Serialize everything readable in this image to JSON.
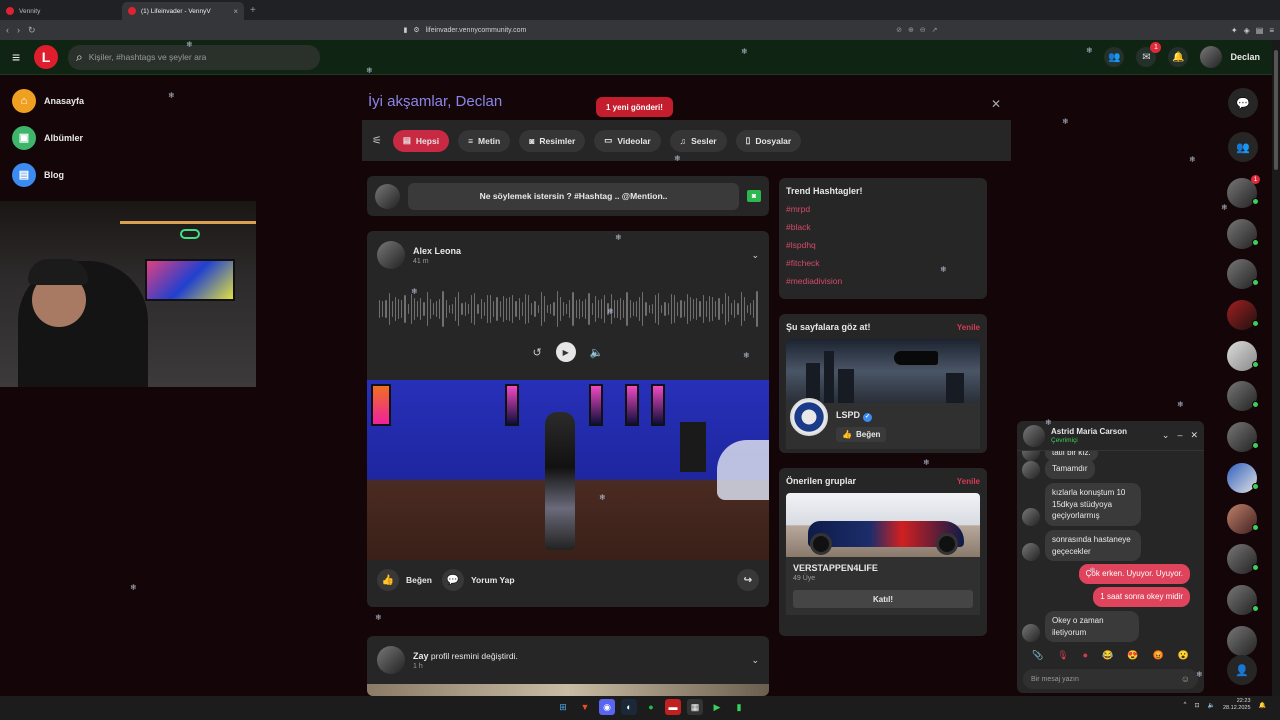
{
  "browser": {
    "tabs": [
      {
        "title": "Vennity",
        "active": false
      },
      {
        "title": "(1) Lifeinvader - VennyV",
        "active": true
      }
    ],
    "new_tab": "+",
    "url": "lifeinvader.vennycommunity.com"
  },
  "header": {
    "search_placeholder": "Kişiler, #hashtags ve şeyler ara",
    "notification_count": "1",
    "user_name": "Declan"
  },
  "left_nav": [
    {
      "label": "Anasayfa",
      "color": "#f0a020",
      "icon": "home-icon"
    },
    {
      "label": "Albümler",
      "color": "#3fb56b",
      "icon": "album-icon"
    },
    {
      "label": "Blog",
      "color": "#3b8bf0",
      "icon": "blog-icon"
    }
  ],
  "feed": {
    "greeting": "İyi akşamlar, Declan",
    "new_posts": "1 yeni gönderi!",
    "filters": [
      "Hepsi",
      "Metin",
      "Resimler",
      "Videolar",
      "Sesler",
      "Dosyalar"
    ],
    "active_filter": "Hepsi",
    "composer_placeholder": "Ne söylemek istersin ? #Hashtag .. @Mention..",
    "post": {
      "author": "Alex Leona",
      "time": "41 m",
      "like_label": "Beğen",
      "comment_label": "Yorum Yap"
    },
    "post2": {
      "author": "Zay",
      "action": "profil resmini değiştirdi.",
      "time": "1 h"
    }
  },
  "trending": {
    "title": "Trend Hashtagler!",
    "tags": [
      "#mrpd",
      "#black",
      "#lspdhq",
      "#fitcheck",
      "#mediadivision"
    ]
  },
  "pages": {
    "title": "Şu sayfalara göz at!",
    "refresh": "Yenile",
    "page_name": "LSPD",
    "like_label": "Beğen"
  },
  "groups": {
    "title": "Önerilen gruplar",
    "refresh": "Yenile",
    "group_name": "VERSTAPPEN4LIFE",
    "members": "49 Üye",
    "join_label": "Katıl!"
  },
  "rail": {
    "badge": "1"
  },
  "chat": {
    "name": "Astrid Maria Carson",
    "status": "Çevrimiçi",
    "messages": [
      {
        "from": "in",
        "text": "tatlı bir kız."
      },
      {
        "from": "in",
        "text": "Tamamdır"
      },
      {
        "from": "in",
        "text": "kızlarla konuştum 10 15dkya stüdyoya geçiyorlarmış"
      },
      {
        "from": "in",
        "text": "sonrasında hastaneye geçecekler"
      },
      {
        "from": "out",
        "text": "Çok erken. Uyuyor. Uyuyor."
      },
      {
        "from": "out",
        "text": "1 saat sonra okey midir"
      },
      {
        "from": "in",
        "text": "Okey o zaman iletiyorum"
      }
    ],
    "input_placeholder": "Bir mesaj yazın"
  },
  "taskbar": {
    "time": "22:23",
    "date": "28.12.2025"
  },
  "colors": {
    "accent": "#c92a43",
    "header_bg": "#102413",
    "page_bg": "#140608",
    "card_bg": "#262626",
    "tag": "#d44a6a",
    "online": "#3ad05a"
  }
}
